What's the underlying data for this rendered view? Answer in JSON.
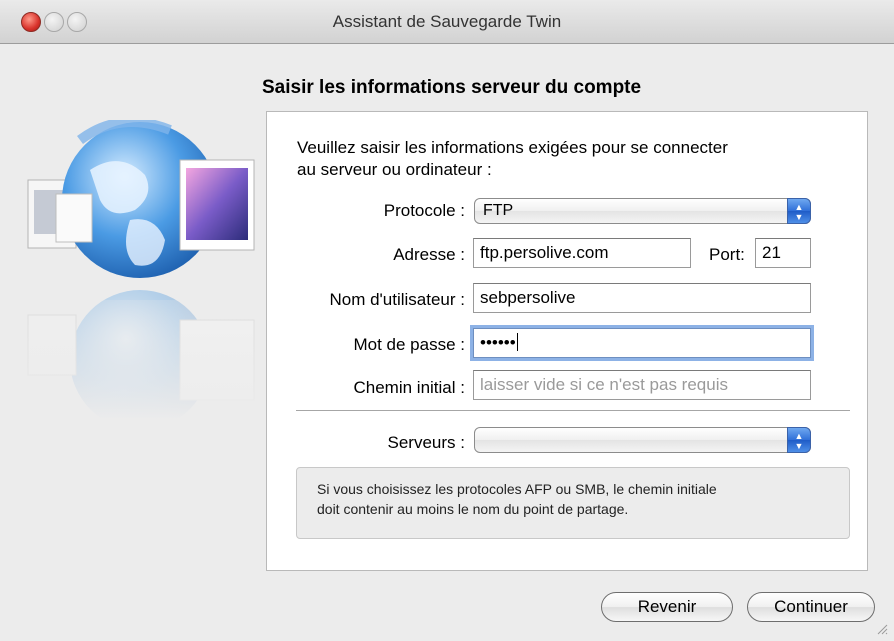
{
  "window": {
    "title": "Assistant de Sauvegarde Twin"
  },
  "heading": "Saisir les informations serveur du compte",
  "intro_line1": "Veuillez saisir les informations exigées pour se connecter",
  "intro_line2": "au serveur ou ordinateur :",
  "form": {
    "protocol_label": "Protocole :",
    "protocol_value": "FTP",
    "address_label": "Adresse :",
    "address_value": "ftp.persolive.com",
    "port_label": "Port:",
    "port_value": "21",
    "username_label": "Nom d'utilisateur :",
    "username_value": "sebpersolive",
    "password_label": "Mot de passe :",
    "password_value": "••••••",
    "path_label": "Chemin initial :",
    "path_placeholder": "laisser vide si ce n'est pas requis",
    "servers_label": "Serveurs :",
    "servers_value": ""
  },
  "info_line1": "Si vous choisissez les protocoles AFP ou SMB, le chemin initiale",
  "info_line2": "doit contenir au moins le nom du point de partage.",
  "buttons": {
    "back": "Revenir",
    "continue": "Continuer"
  },
  "icons": [
    "globe-backup-illustration",
    "popup-stepper-icon",
    "resize-grip-icon"
  ]
}
